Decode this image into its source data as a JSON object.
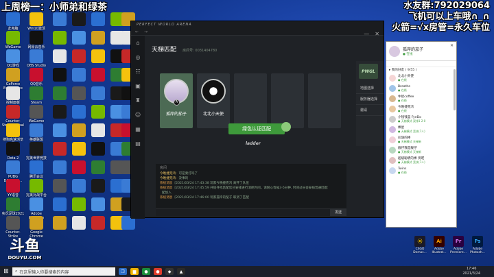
{
  "overlay": {
    "top_left": "上周榜一：小师弟和绿茶",
    "top_right_1": "水友群:792029064",
    "top_right_2": "飞机可以上车哦∩_∩",
    "top_right_3": "火箭=√x房管=永久车位"
  },
  "watermark": {
    "logo": "斗鱼",
    "site": "DOUYU.COM"
  },
  "desktop_icons": [
    "此电脑",
    "WeGame",
    "QQ游戏",
    "GeForce Experience",
    "控制面板",
    "Counter-Strike Global Off...",
    "搜狗高速浏览器",
    "Dota 2",
    "PUBG BATTLEG...",
    "YY语音",
    "实况足球2021",
    "Counter-Strike"
  ],
  "desktop_icons_col2": [
    "Win10激活",
    "网易云音乐",
    "OBS Studio",
    "QQ音乐",
    "Steam",
    "WeGame",
    "英雄联盟",
    "完美世界竞技平台",
    "腾讯会议",
    "完美对战平台",
    "Adobe Premiere",
    "Google Chrome"
  ],
  "window": {
    "brand": "PERFECT WORLD ARENA",
    "room_title": "天梯匹配",
    "room_id": "房间号: 0031404780",
    "players": [
      "孤岸的茄子",
      "北北小天使"
    ],
    "match_button": "绿色认证匹配",
    "mid_logo": "ladder",
    "chat_label": "房间",
    "side_menu": [
      "地图选择",
      "服务器选择",
      "邀请"
    ],
    "pwgl": "PWGL",
    "send": "发送",
    "messages": [
      {
        "who": "今晚捷克鸿:",
        "txt": "可是要打吗了"
      },
      {
        "who": "今晚捷克鸿:",
        "txt": "没事的"
      },
      {
        "sys": "系统消息",
        "txt": "[2021/03/24 17:43:38 玩家今晚捷克鸿 离开了队伍"
      },
      {
        "sys": "系统消息",
        "txt": "[2021/03/24 17:45:59 开始寻找匹配您已安排进行消耗时间。请耐心等候3-5分钟, 时间过长会安排普通匹配"
      },
      {
        "sys": "",
        "txt": "配加入"
      },
      {
        "sys": "系统消息",
        "txt": "[2021/03/24 17:46:00 玩家孤岸的茄子 取消了匹配"
      }
    ]
  },
  "friends": {
    "me": "孤岸的茄子",
    "me_status": "● 在线",
    "search": "",
    "group": "▸ 我的好友 ( 9/55 )",
    "list": [
      {
        "name": "北北小天使",
        "status": "● 在线"
      },
      {
        "name": "Breathe",
        "status": "● 在线"
      },
      {
        "name": "牛奶coffee",
        "status": "● 在线"
      },
      {
        "name": "今晚捷克鸿",
        "status": "● 在线"
      },
      {
        "name": "小钱钱蓝 FyeDo",
        "status": "● 天梯模式 双排1·2·0"
      },
      {
        "name": "棒星",
        "status": "● 天梯模式 竞技(7人)"
      },
      {
        "name": "彩旗的棒",
        "status": "● 天梯模式 天梯新"
      },
      {
        "name": "靓仔我是靓仔",
        "status": "● 天梯模式 天梯新"
      },
      {
        "name": "超级聪明的棒 贤吧",
        "status": "● 天梯模式 竞技(7人)"
      },
      {
        "name": "Twins",
        "status": "● 在线"
      }
    ]
  },
  "right_icons": [
    "CSGO Demos...",
    "Adobe Illustrat...",
    "Adobe Premiere...",
    "Adobe Photosh..."
  ],
  "taskbar": {
    "search": "在这里输入你要搜索的内容",
    "time": "17:46",
    "date": "2021/3/24"
  }
}
